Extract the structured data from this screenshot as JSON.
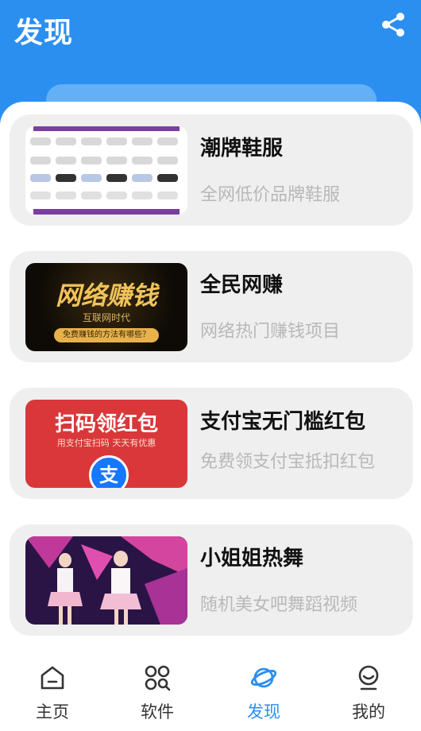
{
  "header": {
    "title": "发现",
    "bg_color": "#2b8ff0"
  },
  "cards": [
    {
      "title": "潮牌鞋服",
      "description": "全网低价品牌鞋服",
      "thumb_icon": "sneakers-catalog-image"
    },
    {
      "title": "全民网赚",
      "description": "网络热门赚钱项目",
      "thumb_text": "网络赚钱",
      "thumb_sub": "互联网时代",
      "thumb_banner": "免费赚钱的方法有哪些？"
    },
    {
      "title": "支付宝无门槛红包",
      "description": "免费领支付宝抵扣红包",
      "thumb_text": "扫码领红包",
      "thumb_sub": "用支付宝扫码 天天有优惠",
      "thumb_logo": "支"
    },
    {
      "title": "小姐姐热舞",
      "description": "随机美女吧舞蹈视频",
      "thumb_icon": "dance-video-image"
    }
  ],
  "nav": {
    "items": [
      {
        "label": "主页",
        "icon": "home-icon"
      },
      {
        "label": "软件",
        "icon": "apps-icon"
      },
      {
        "label": "发现",
        "icon": "planet-icon"
      },
      {
        "label": "我的",
        "icon": "profile-icon"
      }
    ],
    "active_color": "#2b8ff0"
  }
}
